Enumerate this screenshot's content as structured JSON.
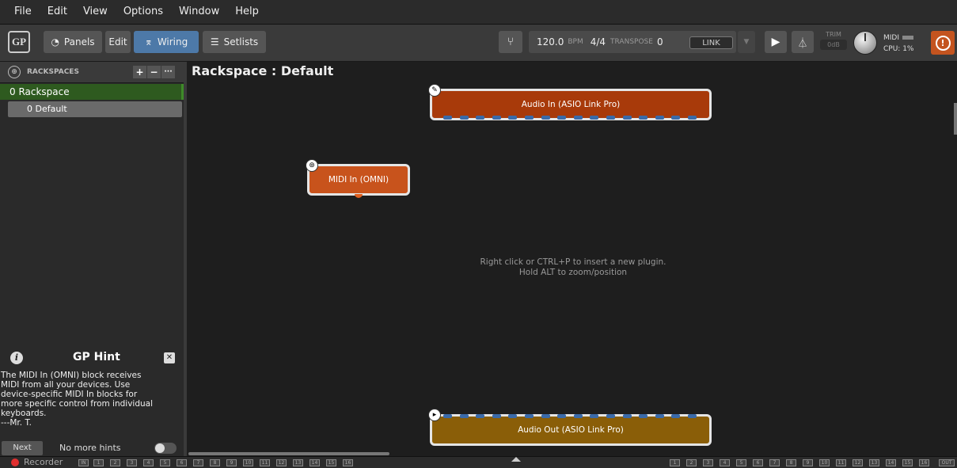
{
  "menu": [
    "File",
    "Edit",
    "View",
    "Options",
    "Window",
    "Help"
  ],
  "toolbar": {
    "logo": "GP",
    "panels_label": "Panels",
    "edit_label": "Edit",
    "wiring_label": "Wiring",
    "setlists_label": "Setlists",
    "bpm_value": "120.0",
    "bpm_unit": "BPM",
    "time_signature": "4/4",
    "transpose_label": "TRANSPOSE",
    "transpose_value": "0",
    "link_label": "LINK",
    "trim_label": "TRIM",
    "trim_value": "0dB",
    "midi_label": "MIDI",
    "cpu_label": "CPU: 1%"
  },
  "rackspaces": {
    "header": "RACKSPACES",
    "rackspace_label": "0  Rackspace",
    "variation_label": "0  Default"
  },
  "hint": {
    "title": "GP Hint",
    "text": "The MIDI In (OMNI) block receives\nMIDI from all your devices. Use\ndevice-specific MIDI In blocks for\nmore specific control from individual\nkeyboards.\n---Mr. T.",
    "next_label": "Next",
    "no_more_label": "No more hints"
  },
  "canvas": {
    "title": "Rackspace : Default",
    "hint_line1": "Right click or CTRL+P to insert a new plugin.",
    "hint_line2": "Hold ALT to zoom/position",
    "blocks": {
      "audio_in": "Audio In (ASIO Link Pro)",
      "midi_in": "MIDI In (OMNI)",
      "audio_out": "Audio Out (ASIO Link Pro)"
    }
  },
  "bottombar": {
    "recorder_label": "Recorder",
    "in_label": "IN",
    "out_label": "OUT",
    "channels": [
      "1",
      "2",
      "3",
      "4",
      "5",
      "6",
      "7",
      "8",
      "9",
      "10",
      "11",
      "12",
      "13",
      "14",
      "15",
      "16"
    ]
  },
  "colors": {
    "audio_in": "#a83a0a",
    "midi_in": "#c8531c",
    "audio_out": "#8a5e08",
    "wiring_active": "#4d79a8",
    "rackspace_selected": "#2e5a1f"
  }
}
